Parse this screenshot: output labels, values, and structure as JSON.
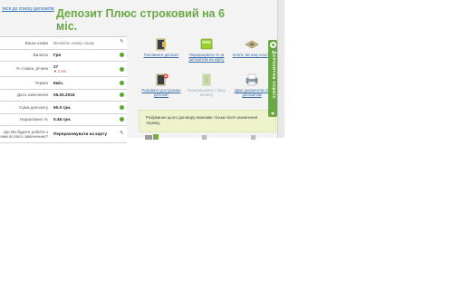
{
  "header": {
    "back_link": "тися до списку депозитів",
    "title": "Депозит Плюс строковий на 6 міс."
  },
  "properties": [
    {
      "label": "Ваша назва",
      "value": "Вкажіть назву назву",
      "style": "muted",
      "icon": "pencil-icon"
    },
    {
      "label": "Валюта",
      "value": "Грн",
      "style": "bold",
      "icon": "info-icon"
    },
    {
      "label": "% ставка, річних",
      "value": "27",
      "sub": "▼ 2.9%",
      "style": "bold",
      "icon": "info-icon"
    },
    {
      "label": "Термін",
      "value": "6міс.",
      "style": "bold",
      "icon": "info-icon"
    },
    {
      "label": "Дата закінчення",
      "value": "05.02.2016",
      "style": "bold",
      "icon": "info-icon"
    },
    {
      "label": "Сума депозиту",
      "value": "50.0 грн.",
      "style": "bold",
      "icon": "info-icon"
    },
    {
      "label": "Нараховано %",
      "value": "0.46 грн.",
      "style": "bold",
      "icon": "info-icon"
    },
    {
      "label": "Що Ви будете робити з ним по його закінченню?",
      "value": "Перераховувати на карту",
      "style": "bold",
      "icon": "pencil-icon"
    }
  ],
  "actions": [
    {
      "label": "Поповнити депозит",
      "icon": "wallet-icon",
      "enabled": true
    },
    {
      "label": "Перерахувати % за депозитом на карту",
      "icon": "card-transfer-icon",
      "enabled": true
    },
    {
      "label": "Зняти частину коштів",
      "icon": "withdraw-icon",
      "enabled": true
    },
    {
      "label": "Розірвати достроково депозит",
      "icon": "close-deposit-icon",
      "enabled": true
    },
    {
      "label": "Перерахувати з іншу валюту",
      "icon": "currency-icon",
      "enabled": false
    },
    {
      "label": "Друк документів по депозитам",
      "icon": "printer-icon",
      "enabled": true
    }
  ],
  "notice": "Розірвання цього договору можливе тільки після зазначення терміну.",
  "widget": {
    "label": "Депозитна сервіс"
  },
  "colors": {
    "accent": "#6aa845",
    "link": "#3b6ea8",
    "notice_bg": "#eef3cc"
  }
}
